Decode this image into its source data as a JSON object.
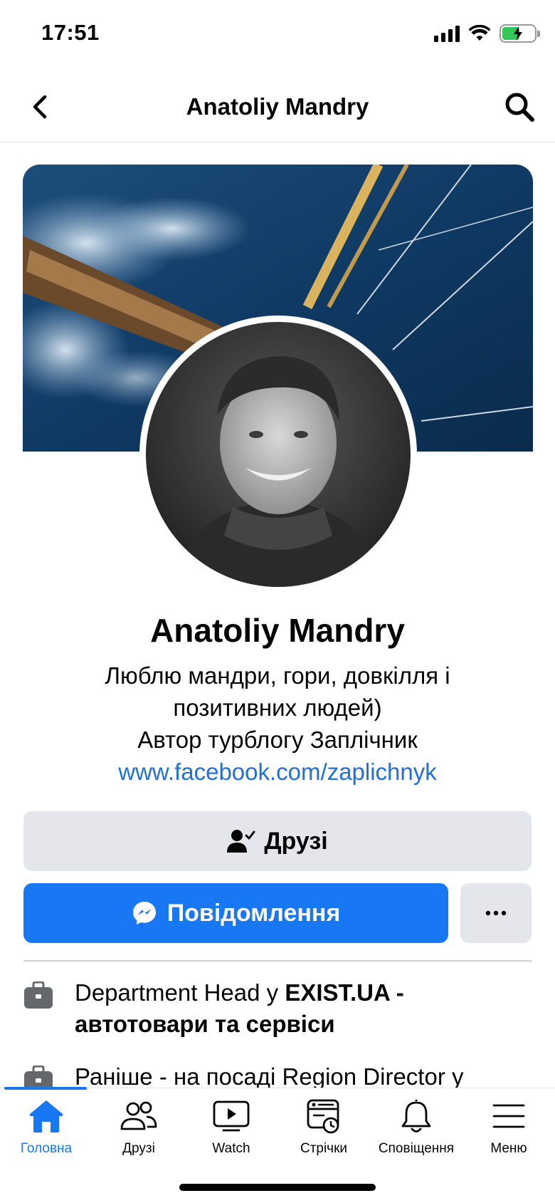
{
  "status_bar": {
    "time": "17:51",
    "battery_level": 0.55
  },
  "nav": {
    "title": "Anatoliy Mandry",
    "back_icon": "chevron-left-icon",
    "search_icon": "search-icon"
  },
  "profile": {
    "name": "Anatoliy Mandry",
    "bio_line1": "Люблю мандри, гори, довкілля і",
    "bio_line2": "позитивних людей)",
    "bio_line3": "Автор турблогу Заплічник",
    "link": "www.facebook.com/zaplichnyk"
  },
  "actions": {
    "friends_label": "Друзі",
    "message_label": "Повідомлення",
    "more_label": "..."
  },
  "work": [
    {
      "prefix": "Department Head у ",
      "bold": "EXIST.UA - автотовари та сервіси"
    },
    {
      "prefix": "Раніше - на посаді Region Director у",
      "bold": ""
    }
  ],
  "tabs": [
    {
      "label": "Головна",
      "icon": "home-icon",
      "active": true
    },
    {
      "label": "Друзі",
      "icon": "friends-icon",
      "active": false
    },
    {
      "label": "Watch",
      "icon": "watch-icon",
      "active": false
    },
    {
      "label": "Стрічки",
      "icon": "feeds-icon",
      "active": false
    },
    {
      "label": "Сповіщення",
      "icon": "bell-icon",
      "active": false
    },
    {
      "label": "Меню",
      "icon": "menu-icon",
      "active": false
    }
  ],
  "colors": {
    "brand": "#1877f2",
    "link": "#216fdb",
    "button_gray": "#e4e6eb"
  }
}
